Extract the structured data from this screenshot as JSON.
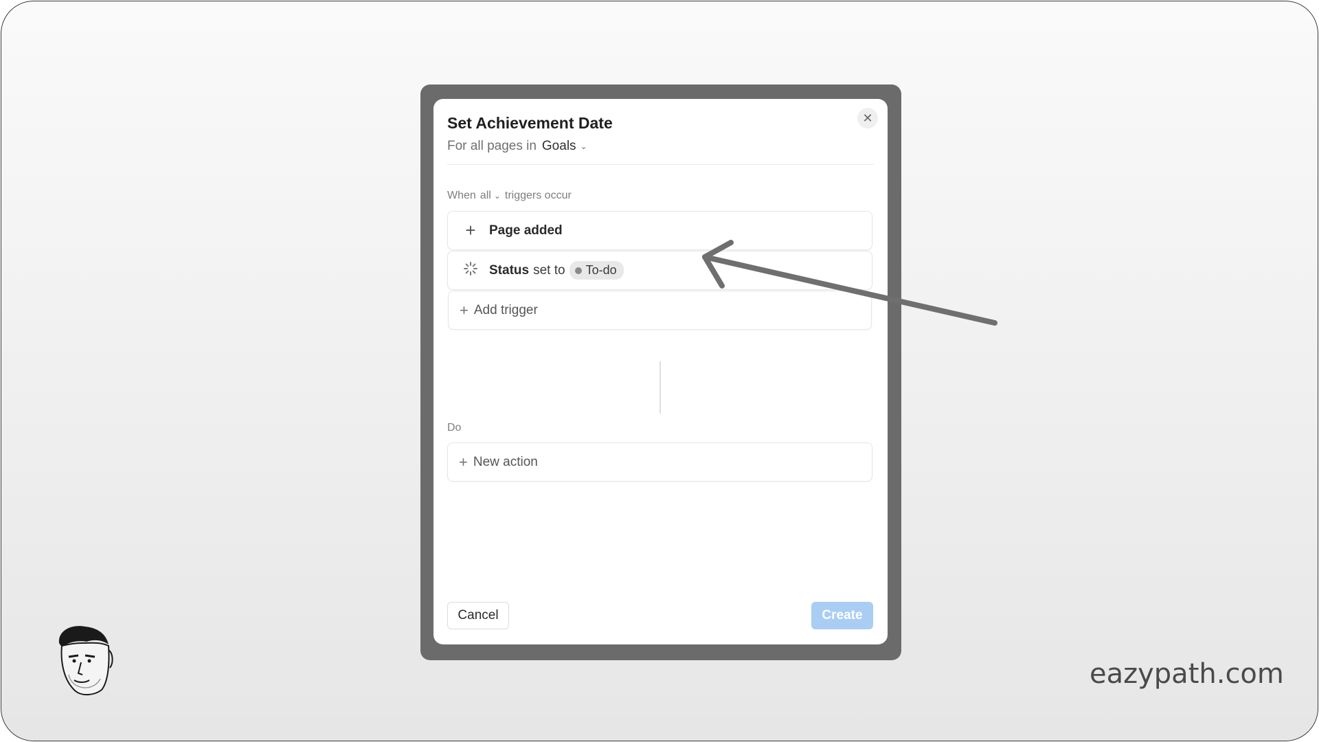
{
  "dialog": {
    "title": "Set Achievement Date",
    "subtitle_prefix": "For all pages in",
    "database": "Goals",
    "close_icon": "close-icon"
  },
  "triggers": {
    "when_prefix": "When",
    "mode": "all",
    "when_suffix": "triggers occur",
    "items": [
      {
        "icon": "plus-icon",
        "label": "Page added"
      },
      {
        "icon": "status-spinner-icon",
        "label": "Status",
        "rest": "set to",
        "value": "To-do"
      }
    ],
    "add_label": "Add trigger"
  },
  "actions": {
    "label": "Do",
    "new_label": "New action"
  },
  "footer": {
    "cancel": "Cancel",
    "create": "Create"
  },
  "brand": "eazypath.com",
  "colors": {
    "create_button": "#a9cdf3",
    "dialog_backdrop": "#6b6b6b"
  }
}
